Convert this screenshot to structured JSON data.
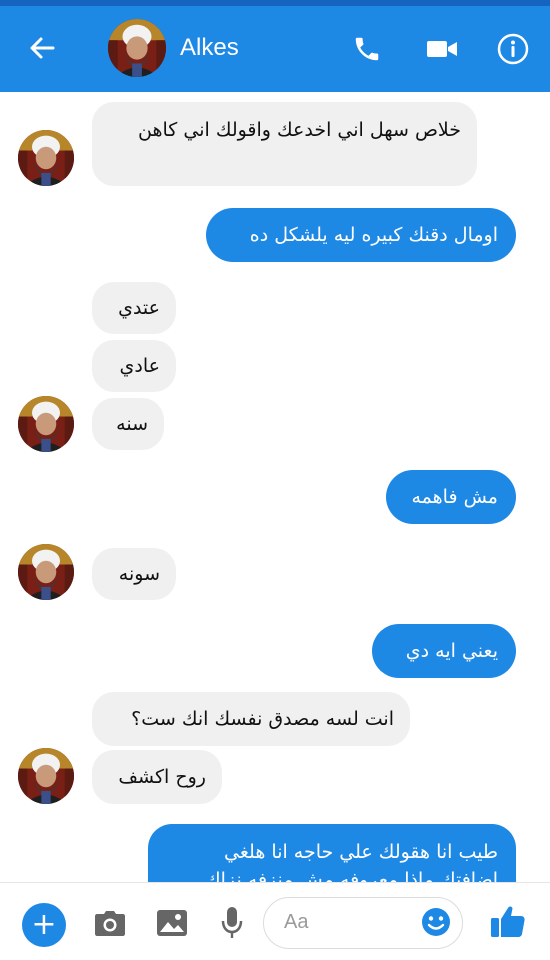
{
  "header": {
    "contact_name": "Alkes",
    "icons": {
      "back": "arrow-left-icon",
      "call": "phone-icon",
      "video": "video-camera-icon",
      "info": "info-icon"
    }
  },
  "messages": [
    {
      "direction": "incoming",
      "text": "خلاص سهل اني اخدعك واقولك اني كاهن"
    },
    {
      "direction": "outgoing",
      "text": "اومال دقنك كبيره ليه يلشكل ده"
    },
    {
      "direction": "incoming",
      "text": "عتدي"
    },
    {
      "direction": "incoming",
      "text": "عادي"
    },
    {
      "direction": "incoming",
      "text": "سنه"
    },
    {
      "direction": "outgoing",
      "text": "مش فاهمه"
    },
    {
      "direction": "incoming",
      "text": "سونه"
    },
    {
      "direction": "outgoing",
      "text": "يعني ايه دي"
    },
    {
      "direction": "incoming",
      "text": "انت لسه مصدق نفسك انك ست؟"
    },
    {
      "direction": "incoming",
      "text": "روح اكشف"
    },
    {
      "direction": "outgoing",
      "text": "طيب انا هقولك علي حاجه انا هلغي اضافتك ماذا معروفه مش منزفه نزاك"
    }
  ],
  "composer": {
    "placeholder": "Aa",
    "icons": {
      "plus": "plus-icon",
      "camera": "camera-icon",
      "gallery": "image-icon",
      "mic": "microphone-icon",
      "emoji": "smiley-icon",
      "like": "thumbs-up-icon"
    }
  },
  "colors": {
    "accent": "#1e88e5",
    "status_bar": "#1565c0",
    "incoming_bubble": "#f0f0f0",
    "outgoing_bubble": "#1e88e5",
    "outgoing_text": "#ffffff",
    "incoming_text": "#111111"
  }
}
